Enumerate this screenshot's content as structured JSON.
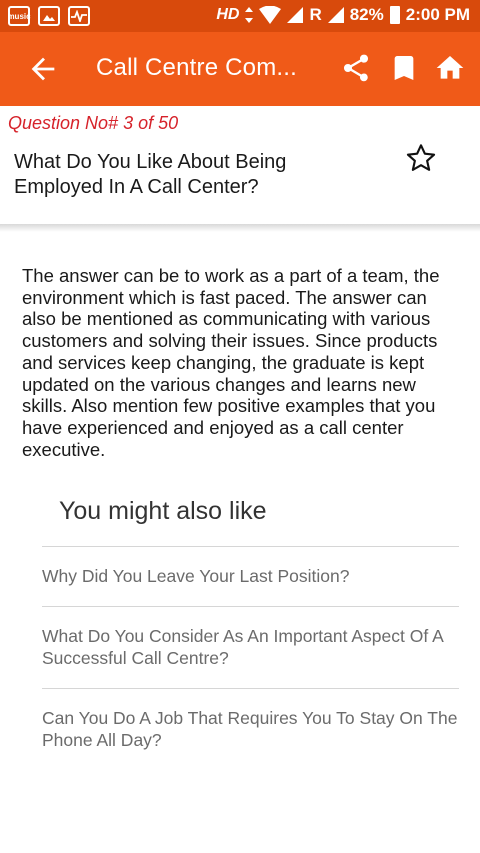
{
  "status_bar": {
    "left_icons": [
      "music-icon",
      "image-icon",
      "activity-icon"
    ],
    "music_label": "music",
    "hd": "HD",
    "roaming": "R",
    "battery": "82%",
    "time": "2:00 PM"
  },
  "app_bar": {
    "title": "Call Centre Com...",
    "color": "#f05a18"
  },
  "question": {
    "number_label": "Question No# 3 of 50",
    "title": "What Do You Like About Being Employed In A Call Center?",
    "answer": "The answer can be to work as a part of a team, the environment which is fast paced. The answer can also be mentioned as communicating with various customers and solving their issues. Since products and services keep changing, the graduate is kept updated on the various changes and learns new skills. Also mention few positive examples that you have experienced and enjoyed as a call center executive."
  },
  "related": {
    "heading": "You might also like",
    "items": [
      "Why Did You Leave Your Last Position?",
      "What Do You Consider As An Important Aspect Of A Successful Call Centre?",
      "Can You Do A Job That Requires You To Stay On The Phone All Day?"
    ]
  }
}
